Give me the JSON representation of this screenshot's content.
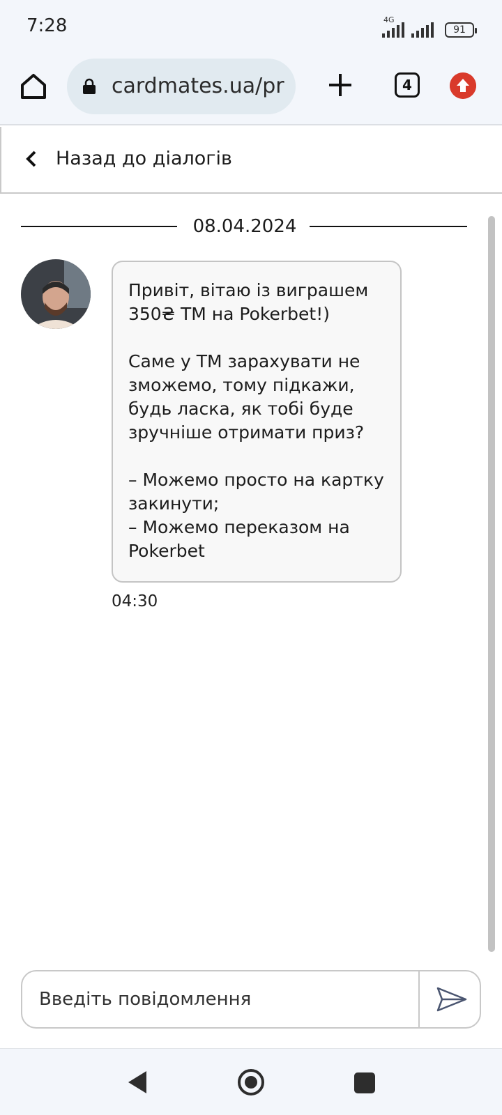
{
  "status_bar": {
    "time": "7:28",
    "network": "4G",
    "battery": "91"
  },
  "browser": {
    "url": "cardmates.ua/prc",
    "tab_count": "4"
  },
  "header": {
    "back_label": "Назад до діалогів"
  },
  "chat": {
    "date": "08.04.2024",
    "messages": [
      {
        "lines": [
          "Привіт, вітаю із виграшем",
          "350₴ ТМ на Pokerbet!)",
          "",
          "Саме у ТМ зарахувати не",
          "зможемо, тому підкажи,",
          "будь ласка, як тобі буде",
          "зручніше отримати приз?",
          "",
          "– Можемо просто на картку",
          "закинути;",
          "– Можемо переказом на",
          "Pokerbet"
        ],
        "time": "04:30"
      }
    ]
  },
  "composer": {
    "placeholder": "Введіть повідомлення",
    "value": ""
  },
  "colors": {
    "update_badge": "#d93a2b",
    "bubble_bg": "#f8f8f8",
    "border": "#c8c8c8"
  }
}
